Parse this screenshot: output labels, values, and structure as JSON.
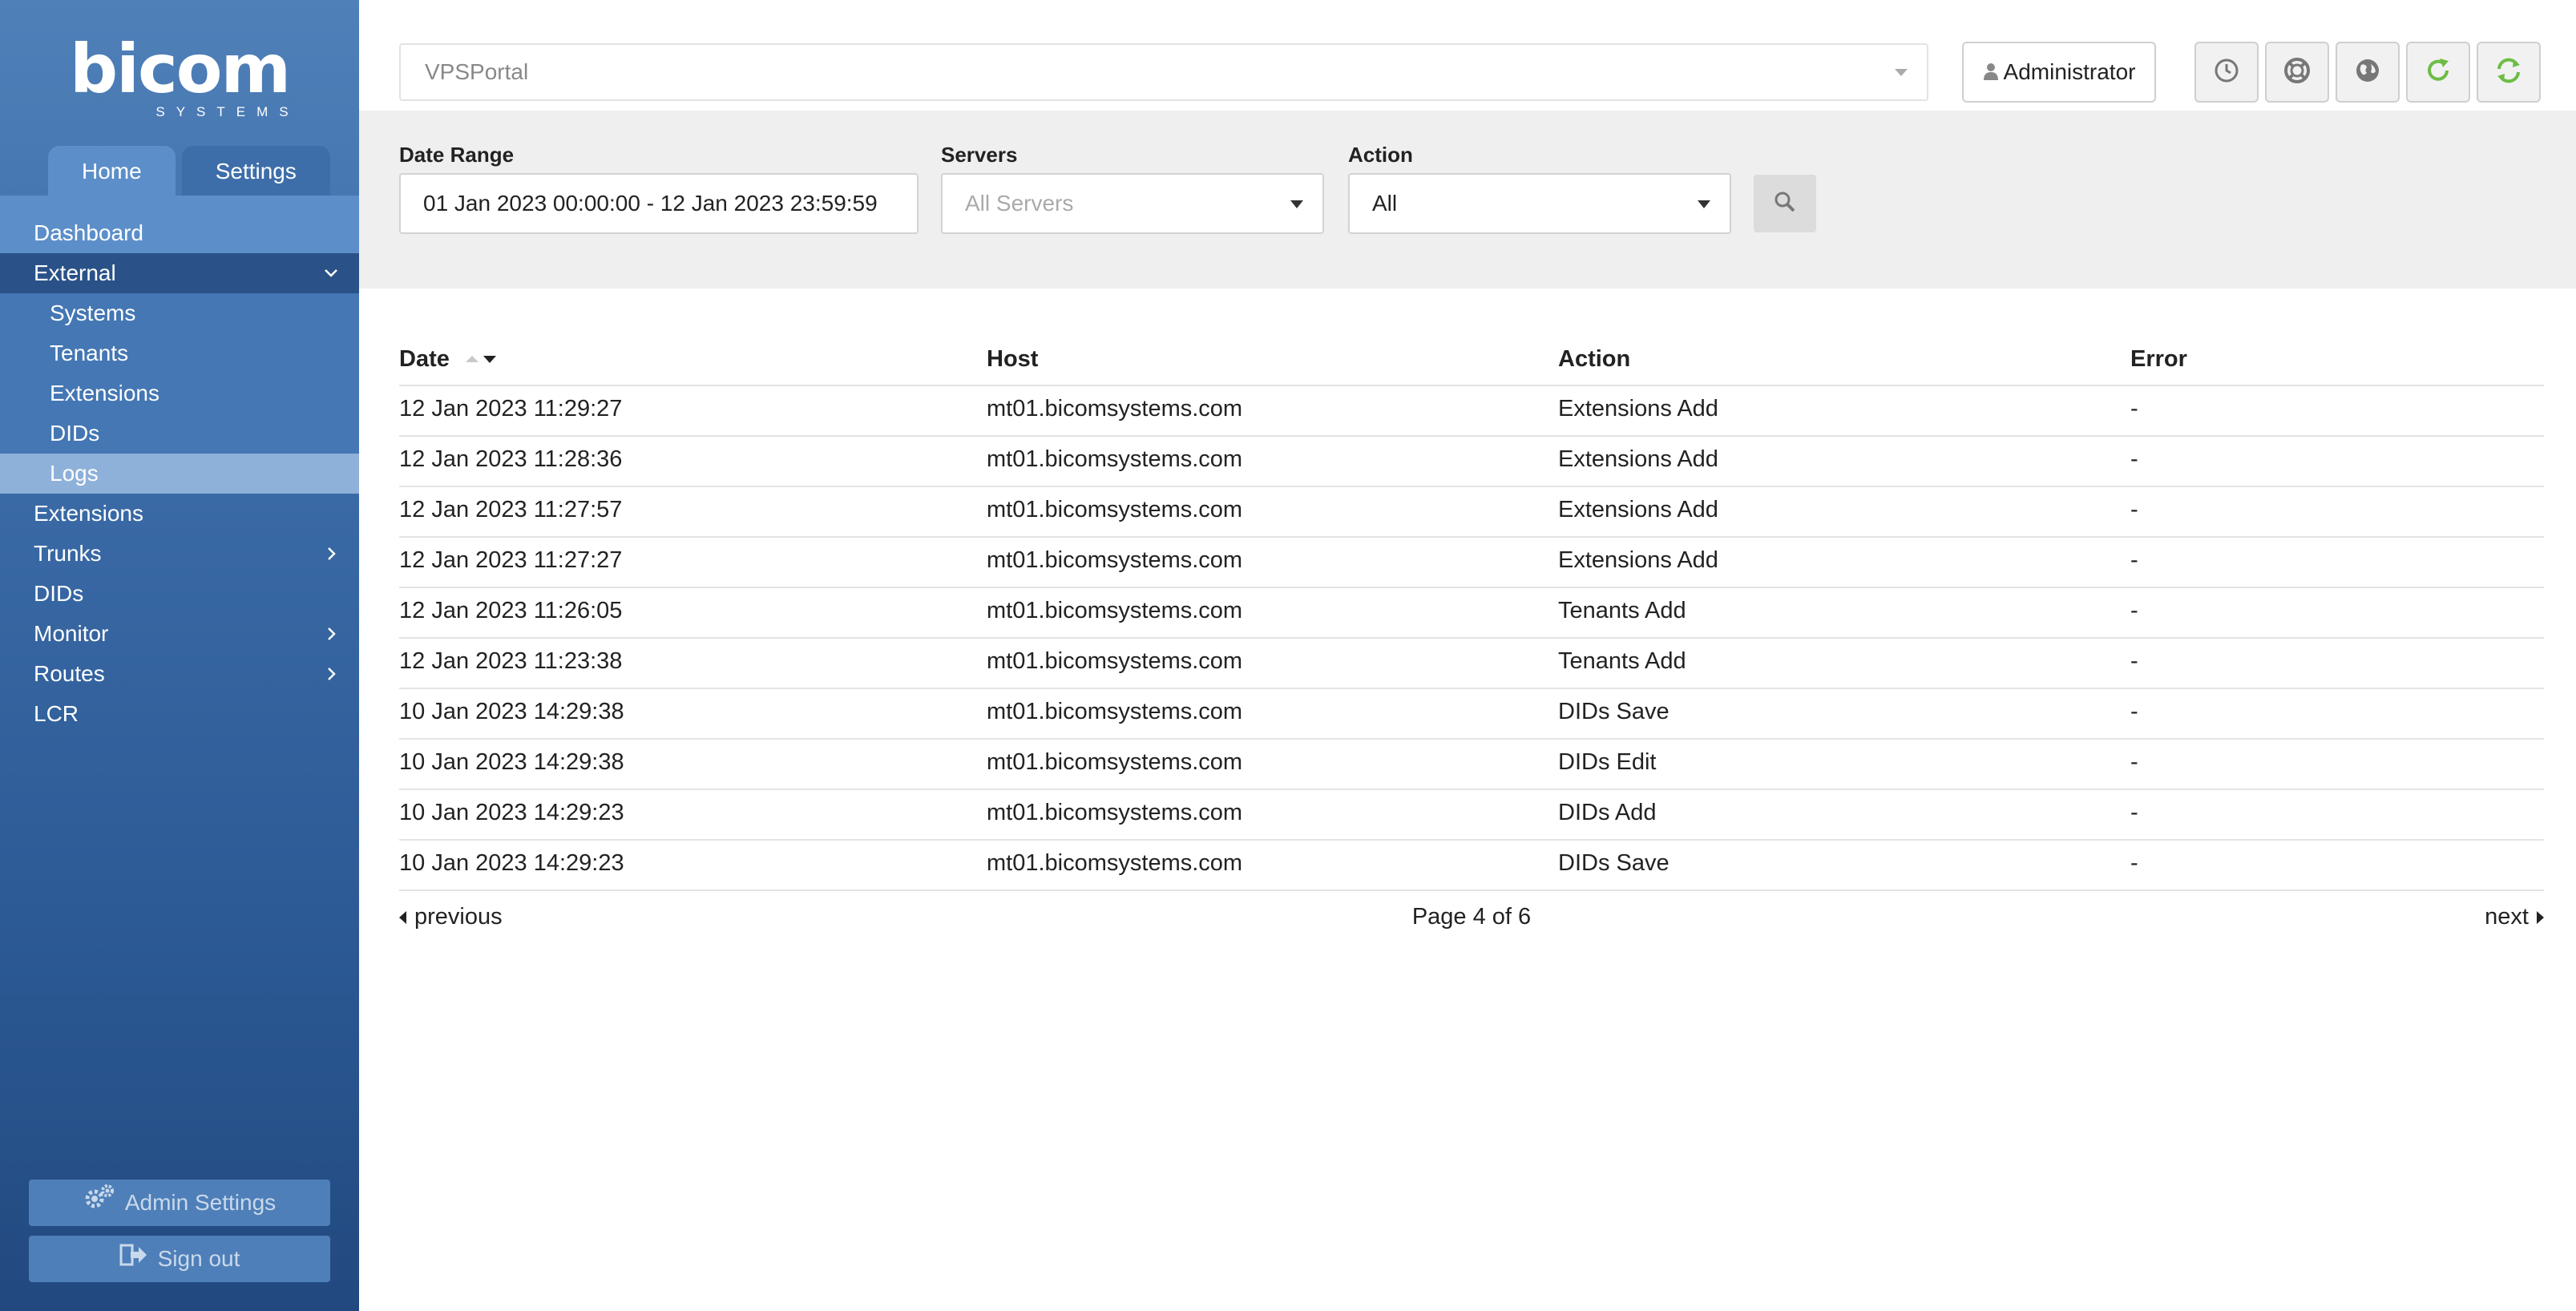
{
  "brand": {
    "logo_text": "bicom",
    "logo_sub": "SYSTEMS"
  },
  "sidebar": {
    "tabs": [
      {
        "label": "Home",
        "active": true
      },
      {
        "label": "Settings",
        "active": false
      }
    ],
    "items": [
      {
        "label": "Dashboard",
        "level": 0
      },
      {
        "label": "External",
        "level": 0,
        "expanded": true
      },
      {
        "label": "Systems",
        "level": 1
      },
      {
        "label": "Tenants",
        "level": 1
      },
      {
        "label": "Extensions",
        "level": 1
      },
      {
        "label": "DIDs",
        "level": 1
      },
      {
        "label": "Logs",
        "level": 1,
        "selected": true
      },
      {
        "label": "Extensions",
        "level": 0
      },
      {
        "label": "Trunks",
        "level": 0,
        "has_children": true
      },
      {
        "label": "DIDs",
        "level": 0
      },
      {
        "label": "Monitor",
        "level": 0,
        "has_children": true
      },
      {
        "label": "Routes",
        "level": 0,
        "has_children": true
      },
      {
        "label": "LCR",
        "level": 0
      }
    ],
    "admin_settings_label": "Admin Settings",
    "sign_out_label": "Sign out"
  },
  "topbar": {
    "portal_select_value": "VPSPortal",
    "user_label": "Administrator",
    "icons": [
      "clock-icon",
      "lifebuoy-icon",
      "globe-icon",
      "refresh-icon",
      "sync-icon"
    ],
    "accent_green": "#6cbd45"
  },
  "filters": {
    "date_range_label": "Date Range",
    "date_range_value": "01 Jan 2023 00:00:00 - 12 Jan 2023 23:59:59",
    "servers_label": "Servers",
    "servers_placeholder": "All Servers",
    "action_label": "Action",
    "action_value": "All"
  },
  "table": {
    "columns": [
      "Date",
      "Host",
      "Action",
      "Error"
    ],
    "rows": [
      [
        "12 Jan 2023 11:29:27",
        "mt01.bicomsystems.com",
        "Extensions Add",
        "-"
      ],
      [
        "12 Jan 2023 11:28:36",
        "mt01.bicomsystems.com",
        "Extensions Add",
        "-"
      ],
      [
        "12 Jan 2023 11:27:57",
        "mt01.bicomsystems.com",
        "Extensions Add",
        "-"
      ],
      [
        "12 Jan 2023 11:27:27",
        "mt01.bicomsystems.com",
        "Extensions Add",
        "-"
      ],
      [
        "12 Jan 2023 11:26:05",
        "mt01.bicomsystems.com",
        "Tenants Add",
        "-"
      ],
      [
        "12 Jan 2023 11:23:38",
        "mt01.bicomsystems.com",
        "Tenants Add",
        "-"
      ],
      [
        "10 Jan 2023 14:29:38",
        "mt01.bicomsystems.com",
        "DIDs Save",
        "-"
      ],
      [
        "10 Jan 2023 14:29:38",
        "mt01.bicomsystems.com",
        "DIDs Edit",
        "-"
      ],
      [
        "10 Jan 2023 14:29:23",
        "mt01.bicomsystems.com",
        "DIDs Add",
        "-"
      ],
      [
        "10 Jan 2023 14:29:23",
        "mt01.bicomsystems.com",
        "DIDs Save",
        "-"
      ]
    ]
  },
  "pager": {
    "previous_label": "previous",
    "page_text": "Page 4 of 6",
    "next_label": "next"
  }
}
